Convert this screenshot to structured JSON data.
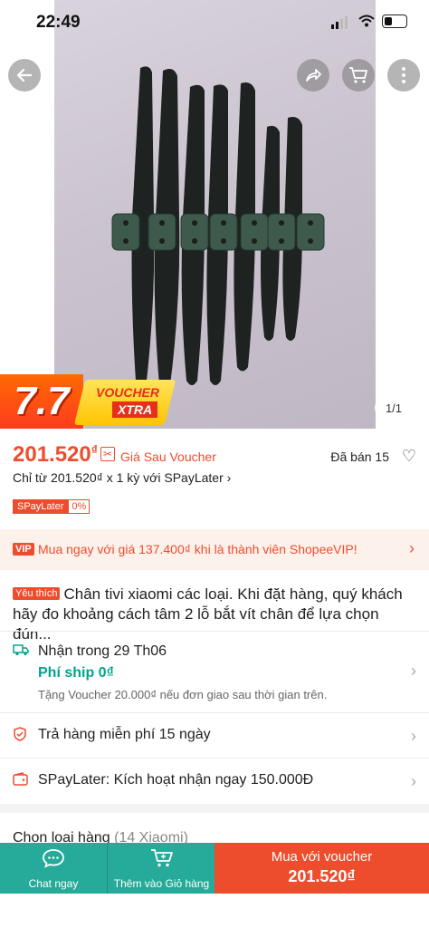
{
  "status": {
    "time": "22:49"
  },
  "gallery": {
    "pager": "1/1"
  },
  "promo": {
    "big": "7.7",
    "line1": "VOUCHER",
    "line2": "XTRA"
  },
  "price": {
    "amount": "201.520",
    "currency": "₫",
    "label": "Giá Sau Voucher",
    "sold": "Đã bán 15",
    "paylater_line": "Chỉ từ 201.520₫ x 1 kỳ với SPayLater ›",
    "tag": "SPayLater",
    "tag_rate": "0%"
  },
  "vip": {
    "label": "VIP",
    "text": "Mua ngay với giá 137.400₫ khi là thành viên ShopeeVIP!"
  },
  "product": {
    "badge": "Yêu thích",
    "title": "Chân tivi xiaomi các loại. Khi đặt hàng, quý khách hãy đo khoảng cách tâm 2 lỗ bắt vít chân để lựa chọn đún..."
  },
  "shipping": {
    "title": "Nhận trong 29 Th06",
    "fee": "Phí ship 0₫",
    "note": "Tặng Voucher 20.000₫ nếu đơn giao sau thời gian trên."
  },
  "returns": {
    "text": "Trả hàng miễn phí 15 ngày"
  },
  "spaylater": {
    "text": "SPayLater: Kích hoạt nhận ngay 150.000Đ"
  },
  "variant": {
    "label": "Chọn loại hàng",
    "count": "(14 Xiaomi)"
  },
  "bottom": {
    "chat": "Chat ngay",
    "cart": "Thêm vào Giỏ hàng",
    "buy_line1": "Mua với voucher",
    "buy_line2": "201.520₫"
  }
}
